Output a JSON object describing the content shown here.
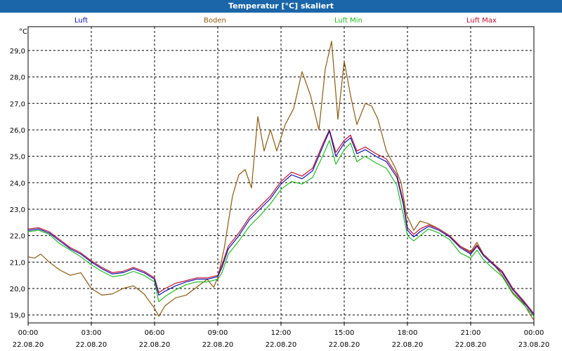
{
  "window": {
    "title": "Temperatur [°C] skaliert"
  },
  "chart_data": {
    "type": "line",
    "title": "Temperatur [°C] skaliert",
    "ylabel": "°C",
    "xlabel": "",
    "ylim": [
      18.7,
      29.9
    ],
    "xlim": [
      0,
      24
    ],
    "grid": true,
    "legend_position": "top",
    "yticks": [
      "19,0",
      "20,0",
      "21,0",
      "22,0",
      "23,0",
      "24,0",
      "25,0",
      "26,0",
      "27,0",
      "28,0",
      "29,0"
    ],
    "xticks": [
      {
        "time": "00:00",
        "date": "22.08.20"
      },
      {
        "time": "03:00",
        "date": "22.08.20"
      },
      {
        "time": "06:00",
        "date": "22.08.20"
      },
      {
        "time": "09:00",
        "date": "22.08.20"
      },
      {
        "time": "12:00",
        "date": "22.08.20"
      },
      {
        "time": "15:00",
        "date": "22.08.20"
      },
      {
        "time": "18:00",
        "date": "22.08.20"
      },
      {
        "time": "21:00",
        "date": "22.08.20"
      },
      {
        "time": "00:00",
        "date": "23.08.20"
      }
    ],
    "series": [
      {
        "name": "Luft",
        "color": "#1010b0",
        "values": [
          [
            0,
            22.2
          ],
          [
            0.5,
            22.25
          ],
          [
            1.0,
            22.1
          ],
          [
            1.5,
            21.8
          ],
          [
            2.0,
            21.5
          ],
          [
            2.5,
            21.3
          ],
          [
            3.0,
            21.0
          ],
          [
            3.5,
            20.75
          ],
          [
            4.0,
            20.55
          ],
          [
            4.5,
            20.6
          ],
          [
            5.0,
            20.75
          ],
          [
            5.5,
            20.6
          ],
          [
            6.0,
            20.35
          ],
          [
            6.2,
            19.75
          ],
          [
            6.5,
            19.9
          ],
          [
            7.0,
            20.1
          ],
          [
            7.5,
            20.25
          ],
          [
            8.0,
            20.35
          ],
          [
            8.5,
            20.35
          ],
          [
            9.0,
            20.45
          ],
          [
            9.2,
            20.8
          ],
          [
            9.5,
            21.5
          ],
          [
            10.0,
            22.0
          ],
          [
            10.5,
            22.6
          ],
          [
            11.0,
            23.0
          ],
          [
            11.5,
            23.4
          ],
          [
            12.0,
            23.95
          ],
          [
            12.5,
            24.3
          ],
          [
            13.0,
            24.15
          ],
          [
            13.5,
            24.45
          ],
          [
            14.0,
            25.4
          ],
          [
            14.3,
            25.95
          ],
          [
            14.6,
            25.0
          ],
          [
            15.0,
            25.5
          ],
          [
            15.3,
            25.7
          ],
          [
            15.6,
            25.1
          ],
          [
            16.0,
            25.25
          ],
          [
            16.5,
            25.0
          ],
          [
            17.0,
            24.8
          ],
          [
            17.5,
            24.2
          ],
          [
            17.8,
            23.2
          ],
          [
            18.0,
            22.2
          ],
          [
            18.3,
            21.95
          ],
          [
            18.6,
            22.15
          ],
          [
            19.0,
            22.35
          ],
          [
            19.5,
            22.2
          ],
          [
            20.0,
            21.95
          ],
          [
            20.5,
            21.55
          ],
          [
            21.0,
            21.3
          ],
          [
            21.3,
            21.6
          ],
          [
            21.6,
            21.25
          ],
          [
            22.0,
            20.95
          ],
          [
            22.5,
            20.6
          ],
          [
            23.0,
            19.95
          ],
          [
            23.5,
            19.5
          ],
          [
            24.0,
            19.0
          ]
        ]
      },
      {
        "name": "Boden",
        "color": "#8a5a10",
        "values": [
          [
            0,
            21.2
          ],
          [
            0.3,
            21.15
          ],
          [
            0.6,
            21.3
          ],
          [
            1.0,
            21.0
          ],
          [
            1.5,
            20.7
          ],
          [
            2.0,
            20.5
          ],
          [
            2.5,
            20.6
          ],
          [
            3.0,
            20.0
          ],
          [
            3.5,
            19.75
          ],
          [
            4.0,
            19.8
          ],
          [
            4.5,
            20.0
          ],
          [
            5.0,
            20.1
          ],
          [
            5.5,
            19.8
          ],
          [
            6.0,
            19.25
          ],
          [
            6.2,
            18.95
          ],
          [
            6.5,
            19.35
          ],
          [
            7.0,
            19.65
          ],
          [
            7.5,
            19.75
          ],
          [
            8.0,
            20.05
          ],
          [
            8.5,
            20.35
          ],
          [
            8.8,
            20.05
          ],
          [
            9.0,
            20.4
          ],
          [
            9.3,
            21.5
          ],
          [
            9.7,
            23.5
          ],
          [
            10.0,
            24.3
          ],
          [
            10.3,
            24.5
          ],
          [
            10.6,
            23.8
          ],
          [
            10.9,
            26.5
          ],
          [
            11.2,
            25.2
          ],
          [
            11.5,
            26.0
          ],
          [
            11.8,
            25.2
          ],
          [
            12.2,
            26.2
          ],
          [
            12.6,
            26.8
          ],
          [
            13.0,
            28.2
          ],
          [
            13.4,
            27.3
          ],
          [
            13.8,
            26.0
          ],
          [
            14.1,
            28.3
          ],
          [
            14.4,
            29.35
          ],
          [
            14.7,
            26.4
          ],
          [
            15.0,
            28.6
          ],
          [
            15.3,
            27.3
          ],
          [
            15.6,
            26.2
          ],
          [
            16.0,
            27.0
          ],
          [
            16.3,
            26.9
          ],
          [
            16.6,
            26.4
          ],
          [
            17.0,
            25.2
          ],
          [
            17.4,
            24.6
          ],
          [
            17.7,
            24.0
          ],
          [
            17.95,
            22.8
          ],
          [
            18.3,
            22.2
          ],
          [
            18.6,
            22.55
          ],
          [
            19.0,
            22.45
          ],
          [
            19.5,
            22.25
          ],
          [
            20.0,
            22.0
          ],
          [
            20.5,
            21.6
          ],
          [
            21.0,
            21.4
          ],
          [
            21.3,
            21.75
          ],
          [
            21.6,
            21.3
          ],
          [
            22.0,
            21.0
          ],
          [
            22.5,
            20.5
          ],
          [
            23.0,
            19.85
          ],
          [
            23.5,
            19.45
          ],
          [
            23.8,
            19.05
          ],
          [
            24.0,
            18.8
          ]
        ]
      },
      {
        "name": "Luft Min",
        "color": "#22bb22",
        "values": [
          [
            0,
            22.15
          ],
          [
            0.5,
            22.2
          ],
          [
            1.0,
            22.05
          ],
          [
            1.5,
            21.7
          ],
          [
            2.0,
            21.45
          ],
          [
            2.5,
            21.2
          ],
          [
            3.0,
            20.9
          ],
          [
            3.5,
            20.65
          ],
          [
            4.0,
            20.45
          ],
          [
            4.5,
            20.5
          ],
          [
            5.0,
            20.65
          ],
          [
            5.5,
            20.5
          ],
          [
            6.0,
            20.25
          ],
          [
            6.2,
            19.5
          ],
          [
            6.5,
            19.7
          ],
          [
            7.0,
            19.95
          ],
          [
            7.5,
            20.15
          ],
          [
            8.0,
            20.25
          ],
          [
            8.5,
            20.25
          ],
          [
            9.0,
            20.35
          ],
          [
            9.2,
            20.6
          ],
          [
            9.5,
            21.3
          ],
          [
            10.0,
            21.8
          ],
          [
            10.5,
            22.35
          ],
          [
            11.0,
            22.75
          ],
          [
            11.5,
            23.2
          ],
          [
            12.0,
            23.75
          ],
          [
            12.5,
            24.05
          ],
          [
            13.0,
            23.95
          ],
          [
            13.5,
            24.2
          ],
          [
            14.0,
            25.05
          ],
          [
            14.3,
            25.6
          ],
          [
            14.6,
            24.7
          ],
          [
            15.0,
            25.25
          ],
          [
            15.3,
            25.5
          ],
          [
            15.6,
            24.8
          ],
          [
            16.0,
            25.0
          ],
          [
            16.5,
            24.75
          ],
          [
            17.0,
            24.55
          ],
          [
            17.5,
            23.9
          ],
          [
            17.8,
            22.8
          ],
          [
            18.0,
            22.0
          ],
          [
            18.3,
            21.8
          ],
          [
            18.6,
            22.0
          ],
          [
            19.0,
            22.25
          ],
          [
            19.5,
            22.1
          ],
          [
            20.0,
            21.85
          ],
          [
            20.5,
            21.35
          ],
          [
            21.0,
            21.15
          ],
          [
            21.3,
            21.45
          ],
          [
            21.6,
            21.1
          ],
          [
            22.0,
            20.8
          ],
          [
            22.5,
            20.45
          ],
          [
            23.0,
            19.8
          ],
          [
            23.5,
            19.4
          ],
          [
            24.0,
            18.95
          ]
        ]
      },
      {
        "name": "Luft Max",
        "color": "#c01030",
        "values": [
          [
            0,
            22.25
          ],
          [
            0.5,
            22.3
          ],
          [
            1.0,
            22.15
          ],
          [
            1.5,
            21.85
          ],
          [
            2.0,
            21.55
          ],
          [
            2.5,
            21.35
          ],
          [
            3.0,
            21.05
          ],
          [
            3.5,
            20.8
          ],
          [
            4.0,
            20.6
          ],
          [
            4.5,
            20.65
          ],
          [
            5.0,
            20.8
          ],
          [
            5.5,
            20.65
          ],
          [
            6.0,
            20.4
          ],
          [
            6.2,
            19.85
          ],
          [
            6.5,
            20.0
          ],
          [
            7.0,
            20.2
          ],
          [
            7.5,
            20.3
          ],
          [
            8.0,
            20.4
          ],
          [
            8.5,
            20.4
          ],
          [
            9.0,
            20.5
          ],
          [
            9.2,
            20.9
          ],
          [
            9.5,
            21.6
          ],
          [
            10.0,
            22.1
          ],
          [
            10.5,
            22.7
          ],
          [
            11.0,
            23.1
          ],
          [
            11.5,
            23.5
          ],
          [
            12.0,
            24.05
          ],
          [
            12.5,
            24.4
          ],
          [
            13.0,
            24.25
          ],
          [
            13.5,
            24.55
          ],
          [
            14.0,
            25.5
          ],
          [
            14.3,
            26.0
          ],
          [
            14.6,
            25.15
          ],
          [
            15.0,
            25.6
          ],
          [
            15.3,
            25.8
          ],
          [
            15.6,
            25.2
          ],
          [
            16.0,
            25.35
          ],
          [
            16.5,
            25.1
          ],
          [
            17.0,
            24.9
          ],
          [
            17.5,
            24.3
          ],
          [
            17.8,
            23.3
          ],
          [
            18.0,
            22.3
          ],
          [
            18.3,
            22.05
          ],
          [
            18.6,
            22.25
          ],
          [
            19.0,
            22.4
          ],
          [
            19.5,
            22.25
          ],
          [
            20.0,
            22.0
          ],
          [
            20.5,
            21.6
          ],
          [
            21.0,
            21.35
          ],
          [
            21.3,
            21.65
          ],
          [
            21.6,
            21.3
          ],
          [
            22.0,
            21.0
          ],
          [
            22.5,
            20.65
          ],
          [
            23.0,
            20.0
          ],
          [
            23.5,
            19.55
          ],
          [
            24.0,
            19.05
          ]
        ]
      }
    ]
  }
}
